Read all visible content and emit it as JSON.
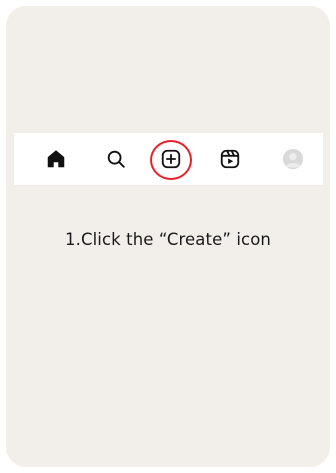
{
  "navbar": {
    "items": [
      {
        "icon": "home-icon"
      },
      {
        "icon": "search-icon"
      },
      {
        "icon": "create-icon"
      },
      {
        "icon": "reels-icon"
      },
      {
        "icon": "avatar"
      }
    ]
  },
  "highlight": {
    "color": "#e8202a",
    "target": "create-icon"
  },
  "instruction": {
    "text": "1.Click the “Create” icon"
  },
  "colors": {
    "card_background": "#f2efea",
    "navbar_background": "#ffffff",
    "icon": "#111111",
    "avatar": "#d9d9d9"
  }
}
